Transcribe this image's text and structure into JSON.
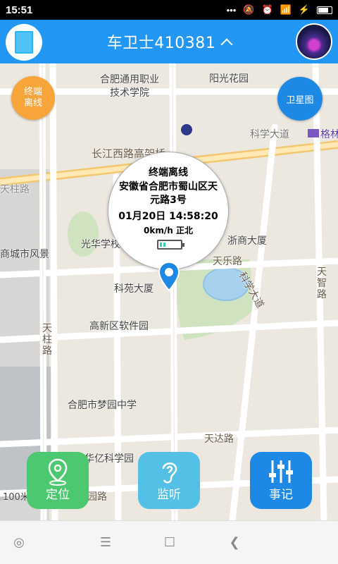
{
  "status_bar": {
    "time": "15:51"
  },
  "app_bar": {
    "title": "车卫士410381"
  },
  "map": {
    "labels": {
      "school": "合肥通用职业\n技术学院",
      "yangguang": "阳光花园",
      "kexue_road": "科学大道",
      "gege": "格林",
      "changjiang_road": "长江西路高架桥",
      "tian": "天柱路",
      "shangcheng": "商城市风景",
      "guanghua": "光华学校",
      "zheshang": "浙商大厦",
      "tianle": "天乐路",
      "kexue_road2": "科学大道",
      "tianzhi": "天\n智\n路",
      "keyuan": "科苑大厦",
      "gaoxin": "高新区软件园",
      "tianzhu_road": "天\n柱\n路",
      "mengyuan": "合肥市梦园中学",
      "tianda": "天达路",
      "huayi": "华亿科学园",
      "hundred": "100米",
      "yuan_road": "园路"
    }
  },
  "buttons": {
    "offline": "终端\n离线",
    "satellite": "卫星图",
    "locate": "定位",
    "listen": "监听",
    "log": "事记"
  },
  "info_bubble": {
    "status": "终端离线",
    "address": "安徽省合肥市蜀山区天元路3号",
    "datetime": "01月20日 14:58:20",
    "speed_dir": "0km/h   正北"
  }
}
